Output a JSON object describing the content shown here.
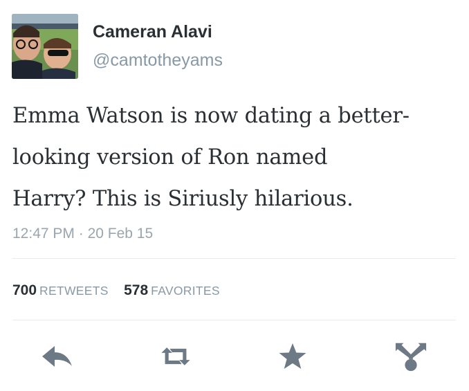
{
  "user": {
    "display_name": "Cameran Alavi",
    "handle": "@camtotheyams",
    "avatar_icon": "profile-photo"
  },
  "tweet": {
    "text_lines": [
      "Emma Watson is now dating a better-",
      "looking version of Ron named",
      "Harry? This is Siriusly hilarious."
    ],
    "time": "12:47 PM",
    "separator": "·",
    "date": "20 Feb 15"
  },
  "stats": {
    "retweets_count": "700",
    "retweets_label": "RETWEETS",
    "favorites_count": "578",
    "favorites_label": "FAVORITES"
  },
  "actions": [
    {
      "name": "reply",
      "icon": "reply-icon"
    },
    {
      "name": "retweet",
      "icon": "retweet-icon"
    },
    {
      "name": "favorite",
      "icon": "star-icon"
    },
    {
      "name": "share",
      "icon": "share-icon"
    }
  ],
  "colors": {
    "text": "#292f33",
    "secondary": "#8899a6",
    "icon": "#6d7a85",
    "divider": "#e6ecf0"
  }
}
